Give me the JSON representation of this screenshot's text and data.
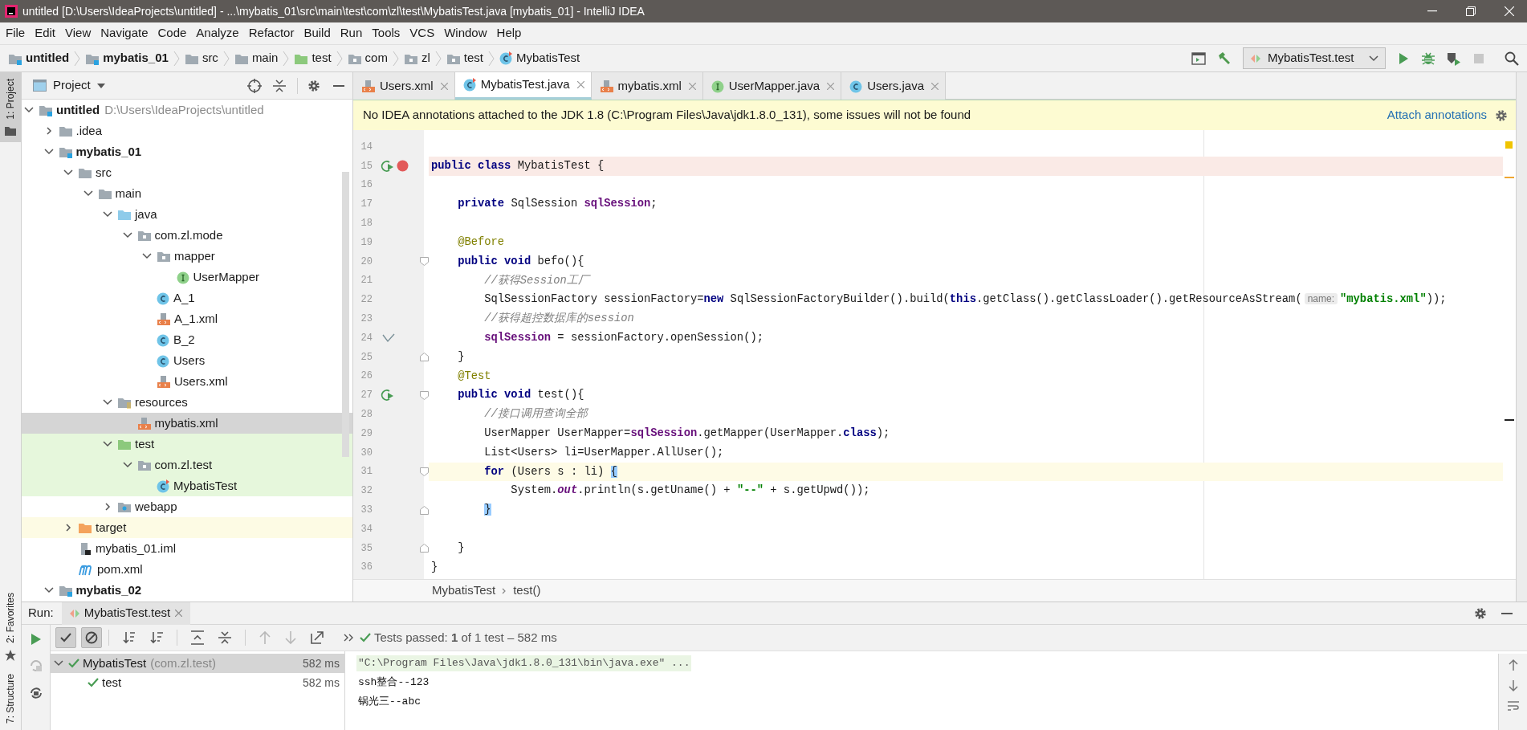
{
  "window": {
    "title": "untitled [D:\\Users\\IdeaProjects\\untitled] - ...\\mybatis_01\\src\\main\\test\\com\\zl\\test\\MybatisTest.java [mybatis_01] - IntelliJ IDEA"
  },
  "menu": [
    "File",
    "Edit",
    "View",
    "Navigate",
    "Code",
    "Analyze",
    "Refactor",
    "Build",
    "Run",
    "Tools",
    "VCS",
    "Window",
    "Help"
  ],
  "breadcrumbs": [
    {
      "label": "untitled",
      "kind": "module"
    },
    {
      "label": "mybatis_01",
      "kind": "module"
    },
    {
      "label": "src",
      "kind": "folder"
    },
    {
      "label": "main",
      "kind": "folder"
    },
    {
      "label": "test",
      "kind": "test-folder"
    },
    {
      "label": "com",
      "kind": "package"
    },
    {
      "label": "zl",
      "kind": "package"
    },
    {
      "label": "test",
      "kind": "package"
    },
    {
      "label": "MybatisTest",
      "kind": "test-class"
    }
  ],
  "run_config": {
    "label": "MybatisTest.test"
  },
  "side_tabs": [
    {
      "label": "1: Project",
      "selected": true
    },
    {
      "label": "2: Favorites",
      "selected": false
    },
    {
      "label": "7: Structure",
      "selected": false
    }
  ],
  "project_panel": {
    "title": "Project",
    "tree": [
      {
        "label": "untitled",
        "path": "D:\\Users\\IdeaProjects\\untitled",
        "kind": "module",
        "expanded": true,
        "selected": false,
        "children": [
          {
            "label": ".idea",
            "kind": "folder",
            "expanded": false,
            "selected": false
          },
          {
            "label": "mybatis_01",
            "kind": "module",
            "expanded": true,
            "selected": false,
            "children": [
              {
                "label": "src",
                "kind": "folder",
                "expanded": true,
                "selected": false,
                "children": [
                  {
                    "label": "main",
                    "kind": "folder",
                    "expanded": true,
                    "selected": false,
                    "children": [
                      {
                        "label": "java",
                        "kind": "source-folder",
                        "expanded": true,
                        "selected": false,
                        "children": [
                          {
                            "label": "com.zl.mode",
                            "kind": "package",
                            "expanded": true,
                            "selected": false,
                            "children": [
                              {
                                "label": "mapper",
                                "kind": "package",
                                "expanded": true,
                                "selected": false,
                                "children": [
                                  {
                                    "label": "UserMapper",
                                    "kind": "interface",
                                    "selected": false
                                  }
                                ]
                              },
                              {
                                "label": "A_1",
                                "kind": "class",
                                "selected": false
                              },
                              {
                                "label": "A_1.xml",
                                "kind": "xml",
                                "selected": false
                              },
                              {
                                "label": "B_2",
                                "kind": "class",
                                "selected": false
                              },
                              {
                                "label": "Users",
                                "kind": "class",
                                "selected": false
                              },
                              {
                                "label": "Users.xml",
                                "kind": "xml",
                                "selected": false
                              }
                            ]
                          }
                        ]
                      },
                      {
                        "label": "resources",
                        "kind": "resources",
                        "expanded": true,
                        "selected": false,
                        "children": [
                          {
                            "label": "mybatis.xml",
                            "kind": "xml",
                            "selected": true
                          }
                        ]
                      },
                      {
                        "label": "test",
                        "kind": "test-folder",
                        "expanded": true,
                        "test_source": true,
                        "selected": false,
                        "children": [
                          {
                            "label": "com.zl.test",
                            "kind": "package",
                            "expanded": true,
                            "test_source": true,
                            "selected": false,
                            "children": [
                              {
                                "label": "MybatisTest",
                                "kind": "test-class",
                                "test_source": true,
                                "selected": false
                              }
                            ]
                          }
                        ]
                      },
                      {
                        "label": "webapp",
                        "kind": "web-folder",
                        "expanded": false,
                        "selected": false
                      }
                    ]
                  }
                ]
              },
              {
                "label": "target",
                "kind": "excluded-folder",
                "expanded": false,
                "excluded": true,
                "selected": false
              },
              {
                "label": "mybatis_01.iml",
                "kind": "iml",
                "selected": false
              },
              {
                "label": "pom.xml",
                "kind": "maven",
                "selected": false
              }
            ]
          },
          {
            "label": "mybatis_02",
            "kind": "module",
            "expanded": true,
            "selected": false
          }
        ]
      }
    ]
  },
  "tabs": [
    {
      "label": "Users.xml",
      "kind": "xml",
      "selected": false
    },
    {
      "label": "MybatisTest.java",
      "kind": "test-class",
      "selected": true
    },
    {
      "label": "mybatis.xml",
      "kind": "xml",
      "selected": false
    },
    {
      "label": "UserMapper.java",
      "kind": "interface",
      "selected": false
    },
    {
      "label": "Users.java",
      "kind": "class",
      "selected": false
    }
  ],
  "banner": {
    "text": "No IDEA annotations attached to the JDK 1.8 (C:\\Program Files\\Java\\jdk1.8.0_131), some issues will not be found",
    "action": "Attach annotations"
  },
  "code": {
    "lines": [
      {
        "number": "14"
      },
      {
        "number": "15",
        "breakpoint_line": true,
        "gutter": [
          {
            "kind": "run"
          },
          {
            "kind": "breakpoint"
          }
        ],
        "tokens": [
          {
            "kind": "kw",
            "text": "public class"
          },
          {
            "kind": "plain",
            "text": " MybatisTest {"
          }
        ]
      },
      {
        "number": "16"
      },
      {
        "number": "17",
        "tokens": [
          {
            "kind": "kw",
            "text": "    private"
          },
          {
            "kind": "plain",
            "text": " SqlSession "
          },
          {
            "kind": "field",
            "text": "sqlSession"
          },
          {
            "kind": "plain",
            "text": ";"
          }
        ]
      },
      {
        "number": "18"
      },
      {
        "number": "19",
        "tokens": [
          {
            "kind": "ann",
            "text": "    @Before"
          }
        ]
      },
      {
        "number": "20",
        "fold_start": true,
        "tokens": [
          {
            "kind": "kw",
            "text": "    public void"
          },
          {
            "kind": "plain",
            "text": " befo(){"
          }
        ]
      },
      {
        "number": "21",
        "tokens": [
          {
            "kind": "comment",
            "text": "        //获得Session工厂"
          }
        ]
      },
      {
        "number": "22",
        "tokens": [
          {
            "kind": "plain",
            "text": "        SqlSessionFactory sessionFactory="
          },
          {
            "kind": "kw",
            "text": "new"
          },
          {
            "kind": "plain",
            "text": " SqlSessionFactoryBuilder().build("
          },
          {
            "kind": "kw",
            "text": "this"
          },
          {
            "kind": "plain",
            "text": ".getClass().getClassLoader().getResourceAsStream("
          },
          {
            "kind": "hint",
            "text": "name:"
          },
          {
            "kind": "str",
            "text": "\"mybatis.xml\""
          },
          {
            "kind": "plain",
            "text": "));"
          }
        ]
      },
      {
        "number": "23",
        "tokens": [
          {
            "kind": "comment",
            "text": "        //获得超控数据库的session"
          }
        ]
      },
      {
        "number": "24",
        "gutter": [
          {
            "kind": "check"
          }
        ],
        "tokens": [
          {
            "kind": "field",
            "text": "        sqlSession"
          },
          {
            "kind": "plain",
            "text": " = sessionFactory.openSession();"
          }
        ]
      },
      {
        "number": "25",
        "fold_end": true,
        "tokens": [
          {
            "kind": "plain",
            "text": "    }"
          }
        ]
      },
      {
        "number": "26",
        "tokens": [
          {
            "kind": "ann",
            "text": "    @Test"
          }
        ]
      },
      {
        "number": "27",
        "fold_start": true,
        "gutter": [
          {
            "kind": "run"
          }
        ],
        "tokens": [
          {
            "kind": "kw",
            "text": "    public void"
          },
          {
            "kind": "plain",
            "text": " test(){"
          }
        ]
      },
      {
        "number": "28",
        "tokens": [
          {
            "kind": "comment",
            "text": "        //接口调用查询全部"
          }
        ]
      },
      {
        "number": "29",
        "tokens": [
          {
            "kind": "plain",
            "text": "        UserMapper UserMapper="
          },
          {
            "kind": "field",
            "text": "sqlSession"
          },
          {
            "kind": "plain",
            "text": ".getMapper(UserMapper."
          },
          {
            "kind": "kw",
            "text": "class"
          },
          {
            "kind": "plain",
            "text": ");"
          }
        ]
      },
      {
        "number": "30",
        "tokens": [
          {
            "kind": "plain",
            "text": "        List<Users> li=UserMapper.AllUser();"
          }
        ]
      },
      {
        "number": "31",
        "caret_line": true,
        "fold_start": true,
        "tokens": [
          {
            "kind": "kw",
            "text": "        for"
          },
          {
            "kind": "plain",
            "text": " (Users s : li) "
          },
          {
            "kind": "match",
            "text": "{"
          }
        ]
      },
      {
        "number": "32",
        "tokens": [
          {
            "kind": "plain",
            "text": "            System."
          },
          {
            "kind": "static",
            "text": "out"
          },
          {
            "kind": "plain",
            "text": ".println(s.getUname() + "
          },
          {
            "kind": "str",
            "text": "\"--\""
          },
          {
            "kind": "plain",
            "text": " + s.getUpwd());"
          }
        ]
      },
      {
        "number": "33",
        "fold_end": true,
        "tokens": [
          {
            "kind": "match",
            "text": "        }"
          }
        ]
      },
      {
        "number": "34"
      },
      {
        "number": "35",
        "fold_end": true,
        "tokens": [
          {
            "kind": "plain",
            "text": "    }"
          }
        ]
      },
      {
        "number": "36",
        "tokens": [
          {
            "kind": "plain",
            "text": "}"
          }
        ]
      }
    ]
  },
  "editor_breadcrumbs": [
    "MybatisTest",
    "test()"
  ],
  "run_panel": {
    "title": "Run:",
    "tab": "MybatisTest.test",
    "toggles": [
      {
        "kind": "show-passed",
        "on": true
      },
      {
        "kind": "show-ignored",
        "on": true
      }
    ],
    "status": "Tests passed: **1** of 1 test – 582 ms",
    "results": [
      {
        "label": "MybatisTest",
        "detail": "(com.zl.test)",
        "time": "582 ms",
        "selected": true,
        "expanded": true,
        "children": [
          {
            "label": "test",
            "time": "582 ms",
            "selected": false
          }
        ]
      }
    ],
    "console": [
      {
        "kind": "command",
        "text": "\"C:\\Program Files\\Java\\jdk1.8.0_131\\bin\\java.exe\" ..."
      },
      {
        "kind": "output",
        "text": "ssh整合--123"
      },
      {
        "kind": "output",
        "text": "锅光三--abc"
      }
    ]
  }
}
